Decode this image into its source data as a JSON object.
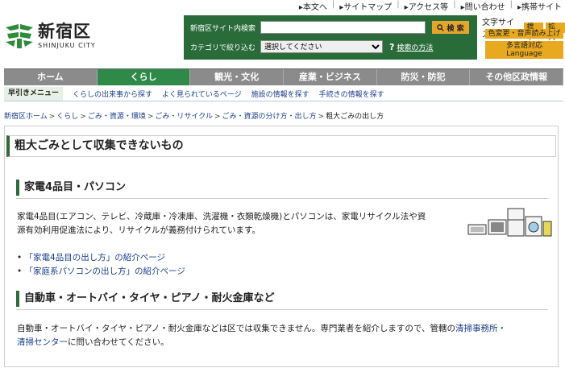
{
  "utility": {
    "items": [
      "本文へ",
      "サイトマップ",
      "アクセス等",
      "問い合わせ",
      "携帯サイト"
    ]
  },
  "logo": {
    "title": "新宿区",
    "subtitle": "SHINJUKU CITY"
  },
  "search": {
    "label": "新宿区サイト内検索",
    "button": "検 索",
    "category_label": "カテゴリで絞り込む",
    "category_selected": "選択してください",
    "help": "検索の方法"
  },
  "fontsize": {
    "label": "文字サイズ",
    "normal": "標準",
    "large": "拡大"
  },
  "buttons": {
    "color": "色変更・音声読み上げ",
    "language_line1": "多言語対応",
    "language_line2": "Language"
  },
  "nav": {
    "items": [
      "ホーム",
      "くらし",
      "観光・文化",
      "産業・ビジネス",
      "防災・防犯",
      "その他区政情報"
    ],
    "active_index": 1
  },
  "quick": {
    "label": "早引きメニュー",
    "links": [
      "くらしの出来事から探す",
      "よく見られているページ",
      "施設の情報を探す",
      "手続きの情報を探す"
    ]
  },
  "breadcrumb": {
    "items": [
      "新宿区ホーム",
      "くらし",
      "ごみ・資源・環境",
      "ごみ・リサイクル",
      "ごみ・資源の分け方・出し方"
    ],
    "current": "粗大ごみの出し方"
  },
  "content": {
    "title": "粗大ごみとして収集できないもの",
    "section1": {
      "heading": "家電4品目・パソコン",
      "para_line1": "家電4品目(エアコン、テレビ、冷蔵庫・冷凍庫、洗濯機・衣類乾燥機)とパソコンは、家電リサイクル法や資",
      "para_line2": "源有効利用促進法により、リサイクルが義務付けられています。",
      "links": [
        "「家電4品目の出し方」の紹介ページ",
        "「家庭系パソコンの出し方」の紹介ページ"
      ]
    },
    "section2": {
      "heading": "自動車・オートバイ・タイヤ・ピアノ・耐火金庫など",
      "para_line1_pre": "自動車・オートバイ・タイヤ・ピアノ・耐火金庫などは区では収集できません。専門業者を紹介しますので、管轄の",
      "para_link_a": "清掃事務所・",
      "para_link_b": "清掃センター",
      "para_line2_post": "に問い合わせてください。"
    }
  },
  "colors": {
    "brand_green": "#2f6b3a",
    "nav_active": "#2f8a4a",
    "accent_orange": "#e8a81f",
    "link": "#1a3e8c"
  }
}
